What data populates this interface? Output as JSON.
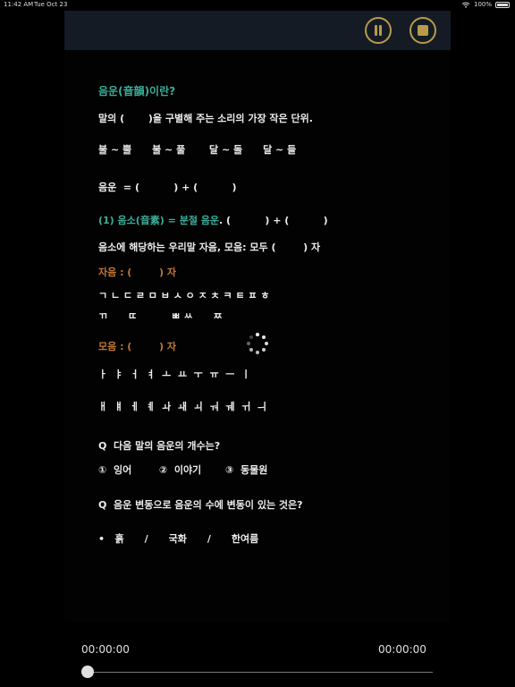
{
  "status_bar": {
    "time": "11:42 AM",
    "date": "Tue Oct 23",
    "battery": "100%"
  },
  "player": {
    "pause_icon": "pause-icon",
    "stop_icon": "stop-icon",
    "current_time": "00:00:00",
    "total_time": "00:00:00",
    "progress": 0,
    "accent_color": "#b99a4a"
  },
  "content": {
    "title": "음운(音韻)이란?",
    "definition": "말의 (       )을 구별해 주는 소리의 가장 작은 단위.",
    "examples": "불 ~ 뿔      불 ~ 풀       달 ~ 돌      달 ~ 들",
    "formula": "음운  = (          ) + (          )",
    "phoneme_line_green": "(1) 음소(音素) = 분절 음운",
    "phoneme_line_rest": ". (          ) + (          )",
    "phoneme_count": "음소에 해당하는 우리말 자음, 모음: 모두 (        ) 자",
    "consonant_label": "자음 : (        ) 자",
    "consonants_basic": "ㄱ ㄴ ㄷ ㄹ ㅁ ㅂ ㅅ ㅇ ㅈ ㅊ ㅋ ㅌ ㅍ ㅎ",
    "consonants_double": "ㄲ      ㄸ          ㅃ ㅆ      ㅉ",
    "vowel_label": "모음 : (        ) 자",
    "vowels_row1": "ㅏ  ㅑ  ㅓ  ㅕ  ㅗ  ㅛ  ㅜ  ㅠ  ㅡ  ㅣ",
    "vowels_row2": "ㅐ  ㅒ  ㅔ  ㅖ  ㅘ  ㅙ  ㅚ  ㅝ  ㅞ  ㅟ  ㅢ",
    "question1": "Q  다음 말의 음운의 개수는?",
    "options": "①  잉어        ②  이야기       ③  동물원",
    "question2": "Q  음운 변동으로 음운의 수에 변동이 있는 것은?",
    "answer_choices": "•   흙      /      국화      /      한여름"
  },
  "colors": {
    "heading": "#3cae9a",
    "label": "#c07832",
    "topbar": "#141b24"
  }
}
